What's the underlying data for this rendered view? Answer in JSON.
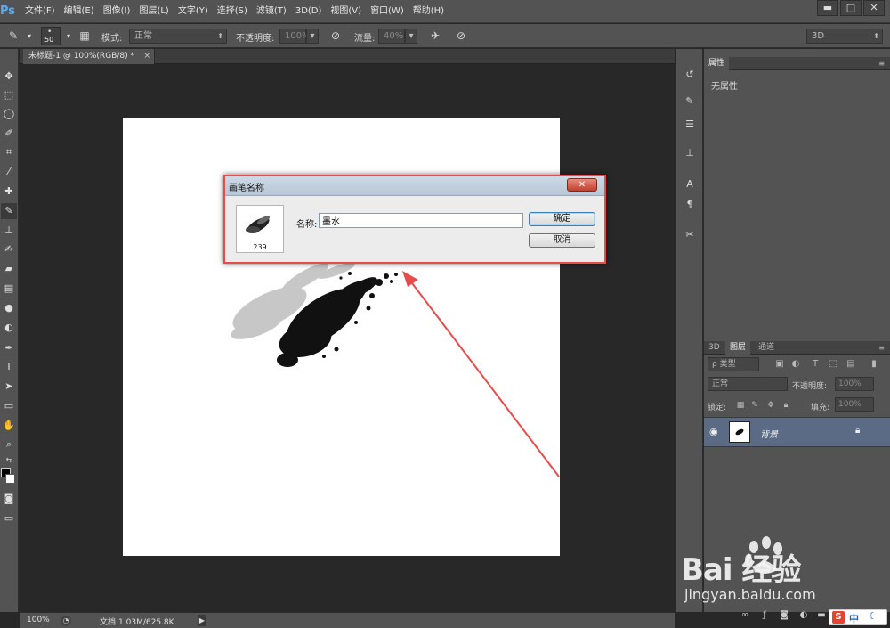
{
  "app": {
    "logo": "Ps"
  },
  "menu": [
    "文件(F)",
    "编辑(E)",
    "图像(I)",
    "图层(L)",
    "文字(Y)",
    "选择(S)",
    "滤镜(T)",
    "3D(D)",
    "视图(V)",
    "窗口(W)",
    "帮助(H)"
  ],
  "window_controls": {
    "minimize": "▬",
    "maximize": "□",
    "close": "✕"
  },
  "options": {
    "brush_size": "50",
    "mode_label": "模式:",
    "mode_value": "正常",
    "opacity_label": "不透明度:",
    "opacity_value": "100%",
    "flow_label": "流量:",
    "flow_value": "40%",
    "workspace": "3D"
  },
  "document_tab": {
    "title": "未标题-1 @ 100%(RGB/8) *",
    "close": "×"
  },
  "dialog": {
    "title": "画笔名称",
    "close": "✕",
    "brush_size": "239",
    "name_label": "名称:",
    "name_value": "墨水",
    "ok_label": "确定",
    "cancel_label": "取消"
  },
  "properties_panel": {
    "tab": "属性",
    "empty_text": "无属性"
  },
  "layers_panel": {
    "tabs": [
      "3D",
      "图层",
      "通道"
    ],
    "filter_label": "ρ 类型",
    "blend_mode": "正常",
    "opacity_label": "不透明度:",
    "opacity_value": "100%",
    "lock_label": "锁定:",
    "fill_label": "填充:",
    "fill_value": "100%",
    "layer_name": "背景"
  },
  "status": {
    "zoom": "100%",
    "info": "文档:1.03M/625.8K"
  },
  "watermark": {
    "brand": "Bai 经验",
    "site": "jingyan.baidu.com"
  },
  "ime": {
    "s": "S",
    "text": "中"
  },
  "colors": {
    "accent_red": "#e74c4c",
    "layer_selected": "#5b6b85",
    "ui_gray": "#535353"
  }
}
